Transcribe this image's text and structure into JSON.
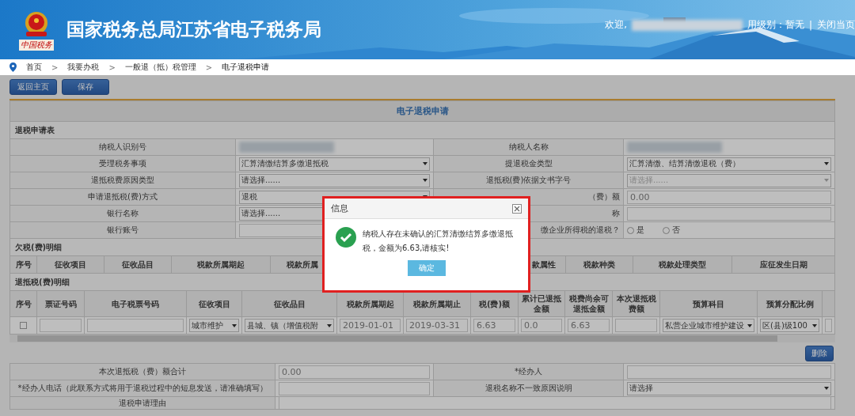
{
  "header": {
    "site_title": "国家税务总局江苏省电子税务局",
    "logo_caption": "中国税务",
    "welcome": "欢迎,",
    "credit_level": "用级别：暂无",
    "separator": "|",
    "close_link": "关闭当页"
  },
  "breadcrumb": [
    {
      "kind": "link",
      "label": "首页"
    },
    {
      "kind": "separator",
      "label": ">"
    },
    {
      "kind": "link",
      "label": "我要办税"
    },
    {
      "kind": "separator",
      "label": ">"
    },
    {
      "kind": "link",
      "label": "一般退（抵）税管理"
    },
    {
      "kind": "separator",
      "label": ">"
    },
    {
      "kind": "current",
      "label": "电子退税申请"
    }
  ],
  "toolbar": {
    "buttons": [
      "返回主页",
      "保存"
    ]
  },
  "panel_title": "电子退税申请",
  "section_title": "退税申请表",
  "form_rows": [
    {
      "cells": [
        {
          "kind": "label",
          "text": "纳税人识别号"
        },
        {
          "kind": "redacted"
        },
        {
          "kind": "label",
          "text": "纳税人名称"
        },
        {
          "kind": "redacted"
        }
      ]
    },
    {
      "cells": [
        {
          "kind": "label",
          "text": "受理税务事项"
        },
        {
          "kind": "select",
          "text": "汇算清缴结算多缴退抵税",
          "disabled": false
        },
        {
          "kind": "label",
          "text": "提退税金类型"
        },
        {
          "kind": "select",
          "text": "汇算清缴、结算清缴退税（费）",
          "disabled": false
        }
      ]
    },
    {
      "cells": [
        {
          "kind": "label",
          "text": "退抵税费原因类型"
        },
        {
          "kind": "select",
          "text": "请选择......",
          "disabled": false
        },
        {
          "kind": "label",
          "text": "退抵税(费)依据文书字号"
        },
        {
          "kind": "select",
          "text": "请选择......",
          "disabled": true
        }
      ]
    },
    {
      "cells": [
        {
          "kind": "label",
          "text": "申请退抵税(费)方式"
        },
        {
          "kind": "select",
          "text": "退税",
          "disabled": false
        },
        {
          "kind": "label",
          "text": "（费）额",
          "covered": true
        },
        {
          "kind": "input",
          "value": "0.00"
        }
      ]
    },
    {
      "cells": [
        {
          "kind": "label",
          "text": "银行名称"
        },
        {
          "kind": "select",
          "text": "请选择......",
          "disabled": false
        },
        {
          "kind": "label",
          "text": "称",
          "covered": true
        },
        {
          "kind": "input"
        }
      ]
    },
    {
      "cells": [
        {
          "kind": "label",
          "text": "银行账号"
        },
        {
          "kind": "input"
        },
        {
          "kind": "label",
          "text": "缴企业所得税的退税？",
          "covered": true
        },
        {
          "kind": "radio",
          "options": [
            {
              "label": "是",
              "selected": false
            },
            {
              "label": "否",
              "selected": false
            }
          ]
        }
      ]
    }
  ],
  "arrears": {
    "title": "欠税(费)明细",
    "columns": [
      "序号",
      "征收项目",
      "征收品目",
      "税款所属期起",
      "税款所属",
      null,
      "款属性",
      "税款种类",
      "税款处理类型",
      "应征发生日期"
    ]
  },
  "refund": {
    "title": "退抵税(费)明细",
    "columns": [
      "序号",
      "票证号码",
      "电子税票号码",
      "征收项目",
      "征收品目",
      "税款所属期起",
      "税款所属期止",
      "税(费)额",
      "累计已退抵金额",
      "税费尚余可退抵金额",
      "本次退抵税费额",
      "预算科目",
      "预算分配比例",
      null
    ],
    "rows": [
      {
        "cells": [
          {
            "kind": "checkbox",
            "checked": false
          },
          {
            "kind": "input"
          },
          {
            "kind": "input"
          },
          {
            "kind": "select",
            "text": "城市维护"
          },
          {
            "kind": "select",
            "text": "县城、镇（增值税附"
          },
          {
            "kind": "input",
            "value": "2019-01-01"
          },
          {
            "kind": "input",
            "value": "2019-03-31"
          },
          {
            "kind": "input",
            "value": "6.63"
          },
          {
            "kind": "input",
            "value": "0.0"
          },
          {
            "kind": "input",
            "value": "6.63"
          },
          {
            "kind": "input"
          },
          {
            "kind": "select",
            "text": "私营企业城市维护建设"
          },
          {
            "kind": "select",
            "text": "区(县)级100"
          },
          {
            "kind": "input"
          }
        ]
      }
    ]
  },
  "delete_button": "删除",
  "summary_rows": [
    {
      "cells": [
        {
          "kind": "label",
          "text": "本次退抵税（费）额合计"
        },
        {
          "kind": "input",
          "value": "0.00"
        },
        {
          "kind": "label",
          "text": "*经办人"
        },
        {
          "kind": "input"
        }
      ]
    },
    {
      "cells": [
        {
          "kind": "label",
          "text": "*经办人电话（此联系方式将用于退税过程中的短息发送，请准确填写）"
        },
        {
          "kind": "input"
        },
        {
          "kind": "label",
          "text": "退税名称不一致原因说明"
        },
        {
          "kind": "select",
          "text": "请选择",
          "disabled": false
        }
      ]
    },
    {
      "cells": [
        {
          "kind": "label",
          "text": "退税申请理由"
        },
        {
          "kind": "textarea"
        }
      ]
    }
  ],
  "dialog": {
    "title": "信息",
    "message": "纳税人存在未确认的汇算清缴结算多缴退抵税，金额为6.63,请核实!",
    "confirm": "确定",
    "highlighted": true
  }
}
